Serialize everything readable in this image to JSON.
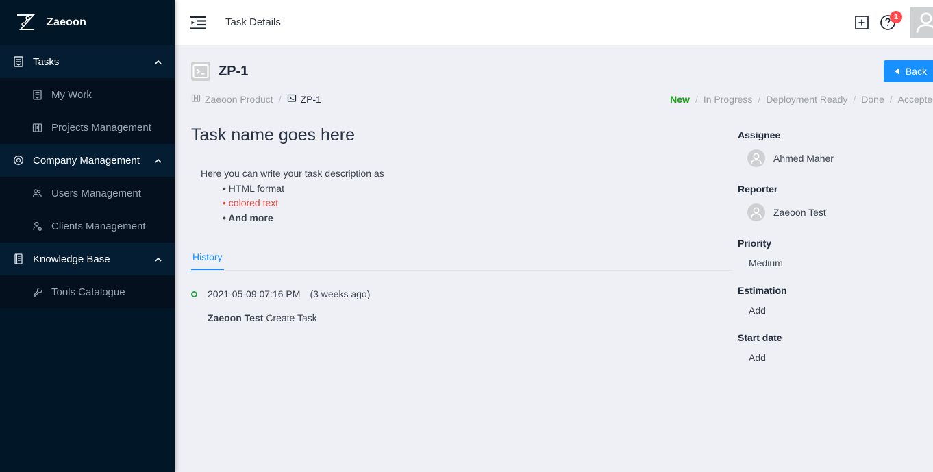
{
  "sidebar": {
    "brand": {
      "name": "Zaeoon",
      "logo_icon": "zaeoon-z-logo"
    },
    "sections": [
      {
        "label": "Tasks",
        "icon": "tasks-icon",
        "chevron": "chevron-up-icon",
        "items": [
          {
            "label": "My Work",
            "icon": "my-work-icon"
          },
          {
            "label": "Projects Management",
            "icon": "projects-icon"
          }
        ]
      },
      {
        "label": "Company Management",
        "icon": "gear-icon",
        "chevron": "chevron-up-icon",
        "items": [
          {
            "label": "Users Management",
            "icon": "users-icon"
          },
          {
            "label": "Clients Management",
            "icon": "client-user-icon"
          }
        ]
      },
      {
        "label": "Knowledge Base",
        "icon": "book-icon",
        "chevron": "chevron-up-icon",
        "items": [
          {
            "label": "Tools Catalogue",
            "icon": "wrench-icon"
          }
        ]
      }
    ]
  },
  "topbar": {
    "fold_icon": "menu-fold-icon",
    "title": "Task Details",
    "plus_icon": "plus-square-icon",
    "help_icon": "question-circle-icon",
    "badge_count": "1",
    "avatar_icon": "user-avatar-icon"
  },
  "page": {
    "task_key": "ZP-1",
    "task_key_icon": "code-terminal-icon",
    "back_label": "Back",
    "back_icon": "caret-left-icon",
    "breadcrumb": [
      {
        "label": "Zaeoon Product",
        "icon": "project-board-icon",
        "current": false
      },
      {
        "label": "ZP-1",
        "icon": "code-terminal-icon",
        "current": true
      }
    ],
    "breadcrumb_separator": "/",
    "statuses": [
      "New",
      "In Progress",
      "Deployment Ready",
      "Done",
      "Accepted"
    ],
    "active_status": "New",
    "status_separator": "/",
    "active_status_color": "#13a10e",
    "task_title": "Task name goes here",
    "description": {
      "lead": "Here you can write your task description as",
      "bullets": [
        {
          "text": "HTML format",
          "style": "normal"
        },
        {
          "text": "colored text",
          "style": "red"
        },
        {
          "text": "And more",
          "style": "bold"
        }
      ]
    },
    "tabs": [
      {
        "label": "History",
        "active": true
      }
    ],
    "history": [
      {
        "timestamp": "2021-05-09 07:16 PM",
        "relative": "(3 weeks ago)",
        "user": "Zaeoon Test",
        "action": "Create Task",
        "dot_color": "#25a244"
      }
    ]
  },
  "details": {
    "assignee": {
      "label": "Assignee",
      "value": "Ahmed Maher",
      "avatar_icon": "user-avatar-icon"
    },
    "reporter": {
      "label": "Reporter",
      "value": "Zaeoon Test",
      "avatar_icon": "user-avatar-icon"
    },
    "priority": {
      "label": "Priority",
      "value": "Medium"
    },
    "estimation": {
      "label": "Estimation",
      "value": "Add"
    },
    "start_date": {
      "label": "Start date",
      "value": "Add"
    }
  },
  "colors": {
    "accent": "#1890ff",
    "sidebar": "#011627",
    "badge": "#ff4d4f",
    "danger_text": "#e8453c"
  }
}
